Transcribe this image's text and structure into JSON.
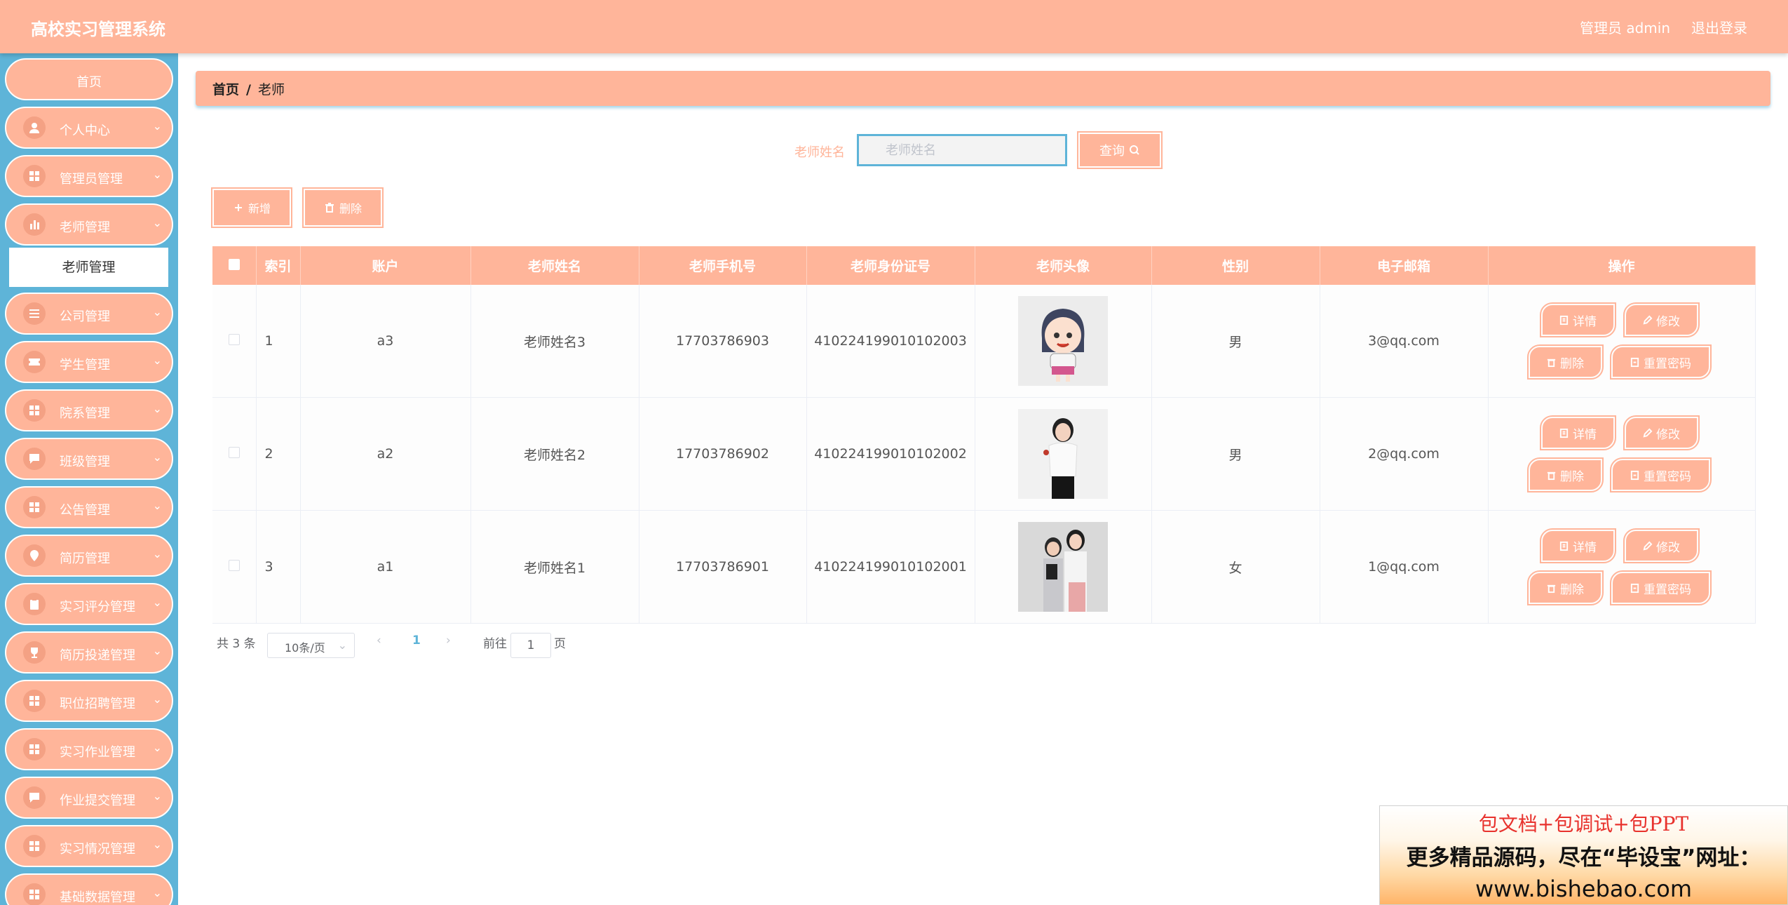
{
  "header": {
    "title": "高校实习管理系统",
    "user": "管理员 admin",
    "logout": "退出登录"
  },
  "sidebar": {
    "home": "首页",
    "items": [
      {
        "label": "个人中心",
        "icon": "user-icon"
      },
      {
        "label": "管理员管理",
        "icon": "grid-icon"
      },
      {
        "label": "老师管理",
        "icon": "bar-chart-icon"
      },
      {
        "label": "公司管理",
        "icon": "list-icon"
      },
      {
        "label": "学生管理",
        "icon": "ticket-icon"
      },
      {
        "label": "院系管理",
        "icon": "grid-icon"
      },
      {
        "label": "班级管理",
        "icon": "chat-icon"
      },
      {
        "label": "公告管理",
        "icon": "grid-icon"
      },
      {
        "label": "简历管理",
        "icon": "location-icon"
      },
      {
        "label": "实习评分管理",
        "icon": "clipboard-icon"
      },
      {
        "label": "简历投递管理",
        "icon": "trophy-icon"
      },
      {
        "label": "职位招聘管理",
        "icon": "grid-icon"
      },
      {
        "label": "实习作业管理",
        "icon": "grid-icon"
      },
      {
        "label": "作业提交管理",
        "icon": "chat-icon"
      },
      {
        "label": "实习情况管理",
        "icon": "grid-icon"
      },
      {
        "label": "基础数据管理",
        "icon": "grid-icon"
      }
    ],
    "submenu_active": "老师管理"
  },
  "breadcrumb": {
    "home": "首页",
    "separator": "/",
    "current": "老师"
  },
  "search": {
    "label": "老师姓名",
    "placeholder": "老师姓名",
    "value": "",
    "button": "查询"
  },
  "toolbar": {
    "add": "新增",
    "delete": "删除"
  },
  "table": {
    "headers": [
      "索引",
      "账户",
      "老师姓名",
      "老师手机号",
      "老师身份证号",
      "老师头像",
      "性别",
      "电子邮箱",
      "操作"
    ],
    "rows": [
      {
        "index": "1",
        "account": "a3",
        "name": "老师姓名3",
        "phone": "17703786903",
        "idcard": "410224199010102003",
        "avatar": "cartoon-girl-avatar",
        "gender": "男",
        "email": "3@qq.com"
      },
      {
        "index": "2",
        "account": "a2",
        "name": "老师姓名2",
        "phone": "17703786902",
        "idcard": "410224199010102002",
        "avatar": "woman-photo-avatar",
        "gender": "男",
        "email": "2@qq.com"
      },
      {
        "index": "3",
        "account": "a1",
        "name": "老师姓名1",
        "phone": "17703786901",
        "idcard": "410224199010102001",
        "avatar": "two-women-photo-avatar",
        "gender": "女",
        "email": "1@qq.com"
      }
    ],
    "actions": {
      "detail": "详情",
      "edit": "修改",
      "delete": "删除",
      "reset": "重置密码"
    }
  },
  "pagination": {
    "total": "共 3 条",
    "page_size": "10条/页",
    "prev": "‹",
    "current": "1",
    "next": "›",
    "goto": "前往",
    "goto_value": "1",
    "page_unit": "页"
  },
  "ad": {
    "line1": "包文档+包调试+包PPT",
    "line2": "更多精品源码，尽在“毕设宝”网址：",
    "line3": "www.bishebao.com"
  },
  "colors": {
    "accent": "#ffb59a",
    "sidebar": "#5eb4d8",
    "header_text": "#ffffff"
  }
}
